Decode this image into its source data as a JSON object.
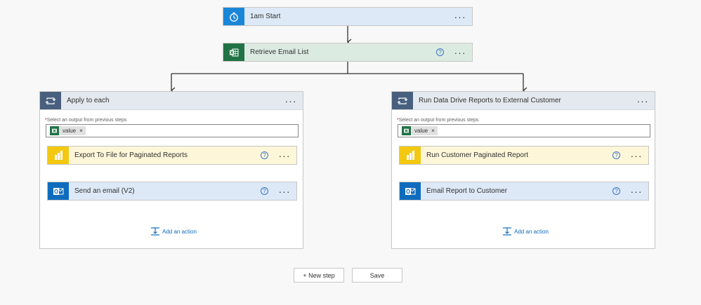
{
  "steps": {
    "trigger": {
      "title": "1am Start",
      "icon": "alarm-clock-icon"
    },
    "retrieve": {
      "title": "Retrieve Email List",
      "icon": "excel-icon"
    }
  },
  "left_branch": {
    "title": "Apply to each",
    "select_label": "Select an output from previous steps",
    "required_mark": "*",
    "token_value": "value",
    "token_remove": "×",
    "actions": [
      {
        "title": "Export To File for Paginated Reports",
        "icon": "power-bi-icon"
      },
      {
        "title": "Send an email (V2)",
        "icon": "outlook-icon"
      }
    ],
    "add_action": "Add an action"
  },
  "right_branch": {
    "title": "Run Data Drive Reports to External Customer",
    "select_label": "Select an output from previous steps",
    "required_mark": "*",
    "token_value": "value",
    "token_remove": "×",
    "actions": [
      {
        "title": "Run Customer Paginated Report",
        "icon": "power-bi-icon"
      },
      {
        "title": "Email Report to Customer",
        "icon": "outlook-icon"
      }
    ],
    "add_action": "Add an action"
  },
  "menu_glyph": "···",
  "help_glyph": "?",
  "footer": {
    "new_step": "+ New step",
    "save": "Save"
  },
  "colors": {
    "trigger_bg": "#dde9f7",
    "excel_bg": "#dcebe2",
    "powerbi_bg": "#fdf6d9",
    "outlook_bg": "#dde9f7",
    "container_header": "#e4e9ef",
    "loop_icon_bg": "#485f7d"
  }
}
